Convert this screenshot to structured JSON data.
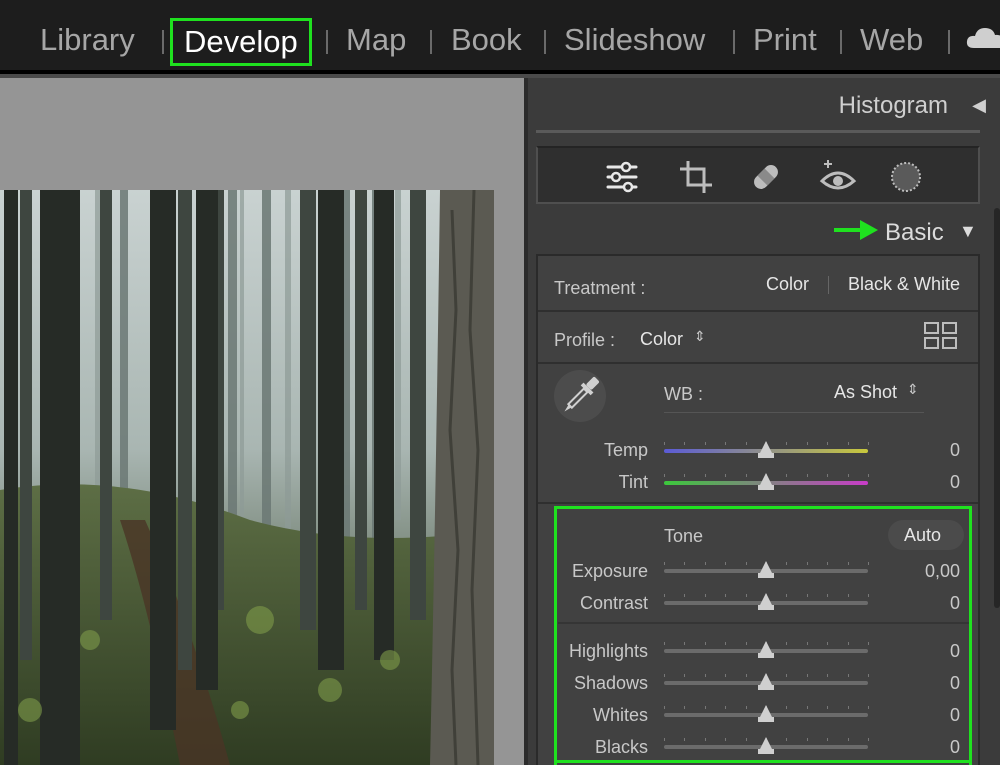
{
  "modules": [
    {
      "label": "Library",
      "active": false
    },
    {
      "label": "Develop",
      "active": true
    },
    {
      "label": "Map",
      "active": false
    },
    {
      "label": "Book",
      "active": false
    },
    {
      "label": "Slideshow",
      "active": false
    },
    {
      "label": "Print",
      "active": false
    },
    {
      "label": "Web",
      "active": false
    }
  ],
  "panel": {
    "histogram_label": "Histogram",
    "tools": [
      "sliders-icon",
      "crop-icon",
      "healing-icon",
      "redeye-icon",
      "masking-icon"
    ],
    "basic_label": "Basic",
    "treatment": {
      "label": "Treatment :",
      "color": "Color",
      "bw": "Black & White"
    },
    "profile": {
      "label": "Profile :",
      "value": "Color"
    },
    "wb": {
      "label": "WB :",
      "value": "As Shot"
    },
    "temp": {
      "label": "Temp",
      "value": "0",
      "level": 0.5
    },
    "tint": {
      "label": "Tint",
      "value": "0",
      "level": 0.5
    },
    "tone": {
      "label": "Tone",
      "auto": "Auto"
    },
    "exposure": {
      "label": "Exposure",
      "value": "0,00",
      "level": 0.5
    },
    "contrast": {
      "label": "Contrast",
      "value": "0",
      "level": 0.5
    },
    "highlights": {
      "label": "Highlights",
      "value": "0",
      "level": 0.5
    },
    "shadows": {
      "label": "Shadows",
      "value": "0",
      "level": 0.5
    },
    "whites": {
      "label": "Whites",
      "value": "0",
      "level": 0.5
    },
    "blacks": {
      "label": "Blacks",
      "value": "0",
      "level": 0.5
    }
  },
  "colors": {
    "highlight_outline": "#1fe11f",
    "arrow": "#1fe11f",
    "temp_gradient": [
      "#5b5bd6",
      "#c8c83c"
    ],
    "tint_gradient": [
      "#3cc83c",
      "#c83cc8"
    ]
  }
}
